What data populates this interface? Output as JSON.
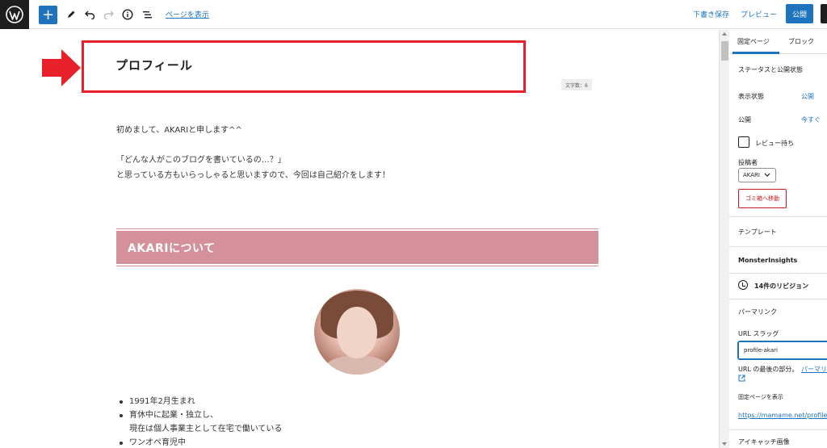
{
  "toolbar": {
    "add_label": "+",
    "view_page": "ページを表示",
    "save_draft": "下書き保存",
    "preview": "プレビュー",
    "publish": "公開"
  },
  "editor": {
    "title": "プロフィール",
    "char_count": "文字数：6",
    "para1": "初めまして、AKARIと申します^^",
    "para2": "「どんな人がこのブログを書いているの…？」",
    "para3": "と思っている方もいらっしゃると思いますので、今回は自己紹介をします！",
    "heading": "AKARIについて",
    "bullets": [
      "1991年2月生まれ",
      "育休中に起業・独立し、",
      "ワンオペ育児中"
    ],
    "bullet_cont": "現在は個人事業主として在宅で働いている"
  },
  "sidebar": {
    "tab_page": "固定ページ",
    "tab_block": "ブロック",
    "status_heading": "ステータスと公開状態",
    "visibility_label": "表示状態",
    "visibility_value": "公開",
    "publish_label": "公開",
    "publish_value": "今すぐ",
    "pending_review": "レビュー待ち",
    "author_label": "投稿者",
    "author_value": "AKARI",
    "trash": "ゴミ箱へ移動",
    "template": "テンプレート",
    "monsterinsights": "MonsterInsights",
    "revisions": "14件のリビジョン",
    "permalink": "パーマリンク",
    "url_slug_label": "URL スラッグ",
    "url_slug_value": "profile-akari",
    "url_hint": "URL の最後の部分。",
    "url_hint_link": "パーマリ",
    "view_page_label": "固定ページを表示",
    "page_url": "https://mamame.net/profile-",
    "featured_image": "アイキャッチ画像"
  },
  "colors": {
    "accent": "#1e73be",
    "highlight_border": "#e8202a",
    "heading_band": "#d4919b",
    "trash": "#cc1818"
  }
}
